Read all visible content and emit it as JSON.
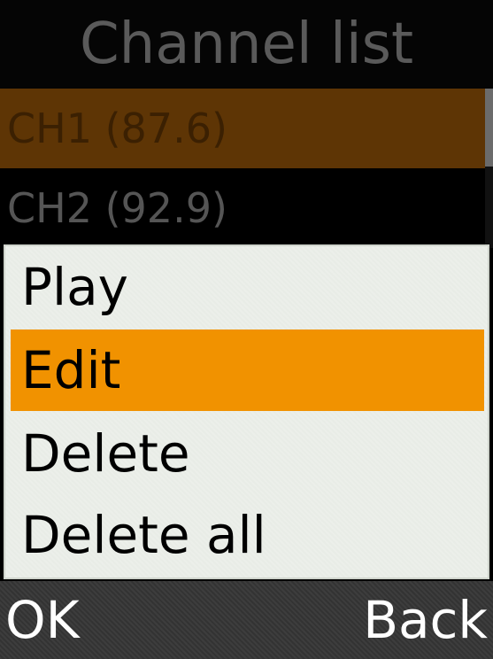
{
  "title": "Channel list",
  "channels": [
    {
      "label": "CH1 (87.6)",
      "selected": true
    },
    {
      "label": "CH2 (92.9)",
      "selected": false
    }
  ],
  "menu": {
    "items": [
      {
        "label": "Play",
        "highlighted": false
      },
      {
        "label": "Edit",
        "highlighted": true
      },
      {
        "label": "Delete",
        "highlighted": false
      },
      {
        "label": "Delete all",
        "highlighted": false
      }
    ]
  },
  "softkeys": {
    "left": "OK",
    "right": "Back"
  },
  "colors": {
    "menu_highlight": "#f19200",
    "selected_channel": "#5e3505",
    "menu_background": "#e8ece6",
    "softkey_bar": "#333333"
  }
}
